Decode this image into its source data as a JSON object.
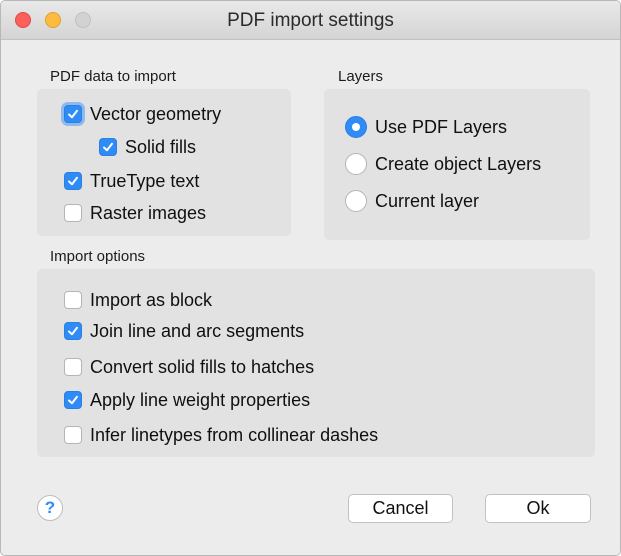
{
  "window": {
    "title": "PDF import settings"
  },
  "pdf_data": {
    "label": "PDF data to import",
    "items": [
      {
        "label": "Vector geometry",
        "checked": true
      },
      {
        "label": "Solid fills",
        "checked": true
      },
      {
        "label": "TrueType text",
        "checked": true
      },
      {
        "label": "Raster images",
        "checked": false
      }
    ]
  },
  "layers": {
    "label": "Layers",
    "options": [
      {
        "label": "Use PDF Layers",
        "selected": true
      },
      {
        "label": "Create object Layers",
        "selected": false
      },
      {
        "label": "Current layer",
        "selected": false
      }
    ]
  },
  "import_options": {
    "label": "Import options",
    "items": [
      {
        "label": "Import as block",
        "checked": false
      },
      {
        "label": "Join line and arc segments",
        "checked": true
      },
      {
        "label": "Convert solid fills to hatches",
        "checked": false
      },
      {
        "label": "Apply line weight properties",
        "checked": true
      },
      {
        "label": "Infer linetypes from collinear dashes",
        "checked": false
      }
    ]
  },
  "footer": {
    "help_label": "?",
    "cancel_label": "Cancel",
    "ok_label": "Ok"
  },
  "colors": {
    "accent": "#2f8cf7",
    "panel": "#e2e2e2",
    "window": "#ececec"
  }
}
